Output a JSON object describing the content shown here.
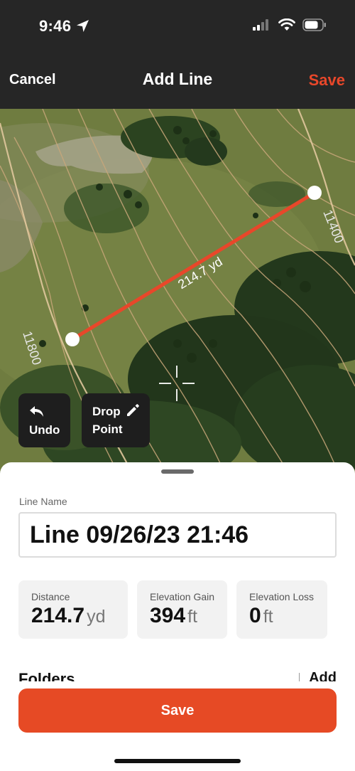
{
  "status_bar": {
    "time": "9:46",
    "icons": [
      "location-arrow-icon",
      "cellular-signal-icon",
      "wifi-icon",
      "battery-icon"
    ]
  },
  "nav": {
    "cancel_label": "Cancel",
    "title": "Add Line",
    "save_label": "Save",
    "save_color": "#e8472a"
  },
  "map": {
    "contour_labels": [
      "11800",
      "11400"
    ],
    "line_length_label": "214.7 yd",
    "line_color": "#e8472a",
    "crosshair_icon": "crosshair-icon",
    "undo_label": "Undo",
    "drop_point_label_1": "Drop",
    "drop_point_label_2": "Point"
  },
  "sheet": {
    "line_name_label": "Line Name",
    "line_name_value": "Line 09/26/23 21:46",
    "stats": [
      {
        "title": "Distance",
        "value": "214.7",
        "unit": "yd"
      },
      {
        "title": "Elevation Gain",
        "value": "394",
        "unit": "ft"
      },
      {
        "title": "Elevation Loss",
        "value": "0",
        "unit": "ft"
      }
    ],
    "folders_label": "Folders",
    "add_label": "Add",
    "save_button_label": "Save",
    "save_button_color": "#e64a25"
  }
}
